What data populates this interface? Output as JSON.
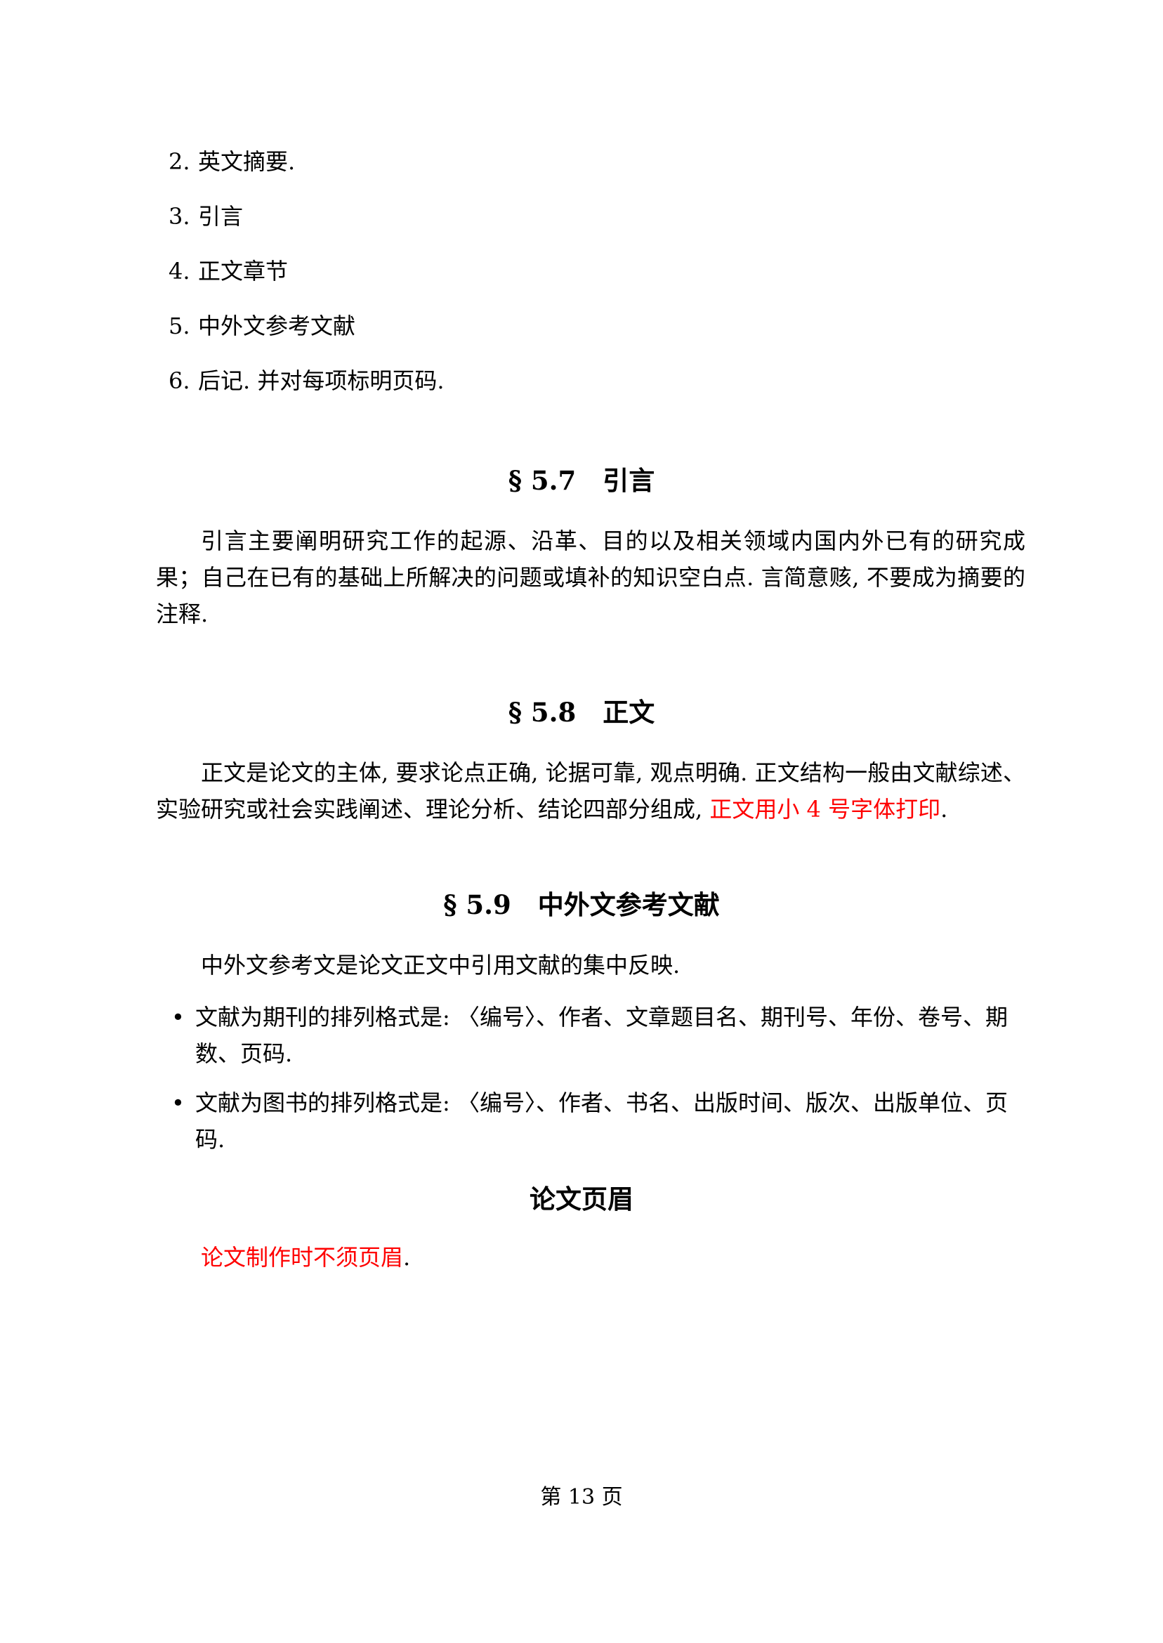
{
  "enum_list": [
    {
      "num": "2.",
      "text": "英文摘要."
    },
    {
      "num": "3.",
      "text": "引言"
    },
    {
      "num": "4.",
      "text": "正文章节"
    },
    {
      "num": "5.",
      "text": "中外文参考文献"
    },
    {
      "num": "6.",
      "text": "后记. 并对每项标明页码."
    }
  ],
  "section_5_7": {
    "number": "§ 5.7",
    "title": "引言",
    "paragraph": "引言主要阐明研究工作的起源、沿革、目的以及相关领域内国内外已有的研究成果；自己在已有的基础上所解决的问题或填补的知识空白点. 言简意赅, 不要成为摘要的注释."
  },
  "section_5_8": {
    "number": "§ 5.8",
    "title": "正文",
    "paragraph_main": "正文是论文的主体, 要求论点正确, 论据可靠, 观点明确. 正文结构一般由文献综述、实验研究或社会实践阐述、理论分析、结论四部分组成, ",
    "paragraph_red": "正文用小 4 号字体打印",
    "paragraph_end": "."
  },
  "section_5_9": {
    "number": "§ 5.9",
    "title": "中外文参考文献",
    "intro": "中外文参考文是论文正文中引用文献的集中反映.",
    "bullets": [
      {
        "marker": "•",
        "text": "文献为期刊的排列格式是: 〈编号〉、作者、文章题目名、期刊号、年份、卷号、期数、页码."
      },
      {
        "marker": "•",
        "text": "文献为图书的排列格式是: 〈编号〉、作者、书名、出版时间、版次、出版单位、页码."
      }
    ]
  },
  "header_section": {
    "title": "论文页眉",
    "note_red": "论文制作时不须页眉",
    "note_end": "."
  },
  "footer": {
    "page_label": "第 13 页"
  },
  "colors": {
    "text": "#000000",
    "highlight": "#ff0000",
    "background": "#ffffff"
  }
}
